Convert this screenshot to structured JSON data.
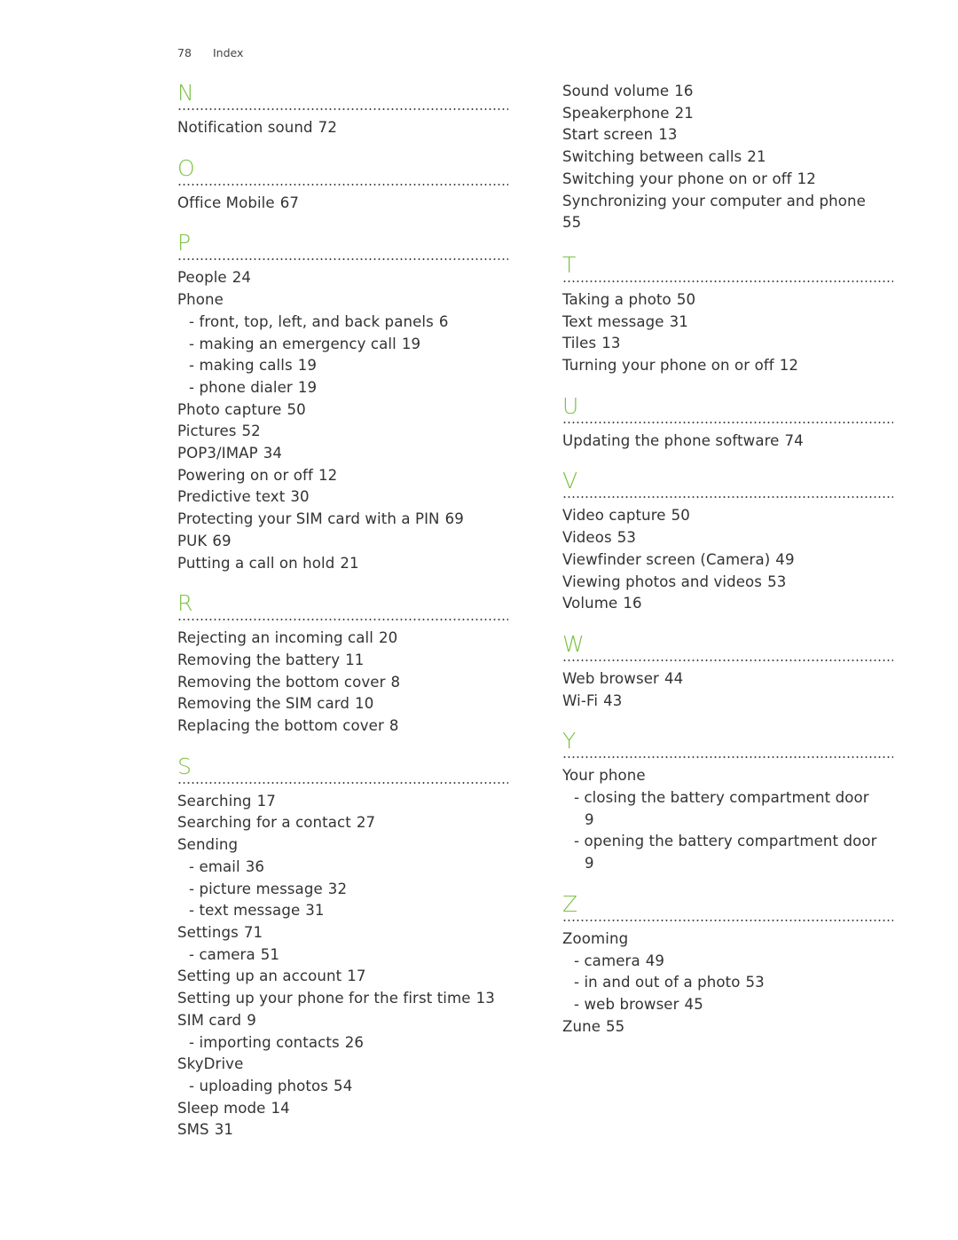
{
  "header": {
    "page_number": "78",
    "title": "Index"
  },
  "accent_color": "#7cc143",
  "left_column": [
    {
      "letter": "N",
      "entries": [
        {
          "text": "Notification sound",
          "page": "72",
          "level": 0
        }
      ]
    },
    {
      "letter": "O",
      "entries": [
        {
          "text": "Office Mobile",
          "page": "67",
          "level": 0
        }
      ]
    },
    {
      "letter": "P",
      "entries": [
        {
          "text": "People",
          "page": "24",
          "level": 0
        },
        {
          "text": "Phone",
          "page": "",
          "level": 0
        },
        {
          "text": "- front, top, left, and back panels",
          "page": "6",
          "level": 1
        },
        {
          "text": "- making an emergency call",
          "page": "19",
          "level": 1
        },
        {
          "text": "- making calls",
          "page": "19",
          "level": 1
        },
        {
          "text": "- phone dialer",
          "page": "19",
          "level": 1
        },
        {
          "text": "Photo capture",
          "page": "50",
          "level": 0
        },
        {
          "text": "Pictures",
          "page": "52",
          "level": 0
        },
        {
          "text": "POP3/IMAP",
          "page": "34",
          "level": 0
        },
        {
          "text": "Powering on or off",
          "page": "12",
          "level": 0
        },
        {
          "text": "Predictive text",
          "page": "30",
          "level": 0
        },
        {
          "text": "Protecting your SIM card with a PIN",
          "page": "69",
          "level": 0
        },
        {
          "text": "PUK",
          "page": "69",
          "level": 0
        },
        {
          "text": "Putting a call on hold",
          "page": "21",
          "level": 0
        }
      ]
    },
    {
      "letter": "R",
      "entries": [
        {
          "text": "Rejecting an incoming call",
          "page": "20",
          "level": 0
        },
        {
          "text": "Removing the battery",
          "page": "11",
          "level": 0
        },
        {
          "text": "Removing the bottom cover",
          "page": "8",
          "level": 0
        },
        {
          "text": "Removing the SIM card",
          "page": "10",
          "level": 0
        },
        {
          "text": "Replacing the bottom cover",
          "page": "8",
          "level": 0
        }
      ]
    },
    {
      "letter": "S",
      "entries": [
        {
          "text": "Searching",
          "page": "17",
          "level": 0
        },
        {
          "text": "Searching for a contact",
          "page": "27",
          "level": 0
        },
        {
          "text": "Sending",
          "page": "",
          "level": 0
        },
        {
          "text": "- email",
          "page": "36",
          "level": 1
        },
        {
          "text": "- picture message",
          "page": "32",
          "level": 1
        },
        {
          "text": "- text message",
          "page": "31",
          "level": 1
        },
        {
          "text": "Settings",
          "page": "71",
          "level": 0
        },
        {
          "text": "- camera",
          "page": "51",
          "level": 1
        },
        {
          "text": "Setting up an account",
          "page": "17",
          "level": 0
        },
        {
          "text": "Setting up your phone for the first time",
          "page": "13",
          "level": 0
        },
        {
          "text": "SIM card",
          "page": "9",
          "level": 0
        },
        {
          "text": "- importing contacts",
          "page": "26",
          "level": 1
        },
        {
          "text": "SkyDrive",
          "page": "",
          "level": 0
        },
        {
          "text": "- uploading photos",
          "page": "54",
          "level": 1
        },
        {
          "text": "Sleep mode",
          "page": "14",
          "level": 0
        },
        {
          "text": "SMS",
          "page": "31",
          "level": 0
        }
      ]
    }
  ],
  "right_column": [
    {
      "letter": "",
      "entries": [
        {
          "text": "Sound volume",
          "page": "16",
          "level": 0
        },
        {
          "text": "Speakerphone",
          "page": "21",
          "level": 0
        },
        {
          "text": "Start screen",
          "page": "13",
          "level": 0
        },
        {
          "text": "Switching between calls",
          "page": "21",
          "level": 0
        },
        {
          "text": "Switching your phone on or off",
          "page": "12",
          "level": 0
        },
        {
          "text": "Synchronizing your computer and phone",
          "page": "55",
          "level": 0,
          "wrap": true
        }
      ]
    },
    {
      "letter": "T",
      "entries": [
        {
          "text": "Taking a photo",
          "page": "50",
          "level": 0
        },
        {
          "text": "Text message",
          "page": "31",
          "level": 0
        },
        {
          "text": "Tiles",
          "page": "13",
          "level": 0
        },
        {
          "text": "Turning your phone on or off",
          "page": "12",
          "level": 0
        }
      ]
    },
    {
      "letter": "U",
      "entries": [
        {
          "text": "Updating the phone software",
          "page": "74",
          "level": 0
        }
      ]
    },
    {
      "letter": "V",
      "entries": [
        {
          "text": "Video capture",
          "page": "50",
          "level": 0
        },
        {
          "text": "Videos",
          "page": "53",
          "level": 0
        },
        {
          "text": "Viewfinder screen (Camera)",
          "page": "49",
          "level": 0
        },
        {
          "text": "Viewing photos and videos",
          "page": "53",
          "level": 0
        },
        {
          "text": "Volume",
          "page": "16",
          "level": 0
        }
      ]
    },
    {
      "letter": "W",
      "entries": [
        {
          "text": "Web browser",
          "page": "44",
          "level": 0
        },
        {
          "text": "Wi-Fi",
          "page": "43",
          "level": 0
        }
      ]
    },
    {
      "letter": "Y",
      "entries": [
        {
          "text": "Your phone",
          "page": "",
          "level": 0
        },
        {
          "text": "- closing the battery compartment door",
          "page": "9",
          "level": 1,
          "wrap": true
        },
        {
          "text": "- opening the battery compartment door",
          "page": "9",
          "level": 1,
          "wrap": true
        }
      ]
    },
    {
      "letter": "Z",
      "entries": [
        {
          "text": "Zooming",
          "page": "",
          "level": 0
        },
        {
          "text": "- camera",
          "page": "49",
          "level": 1
        },
        {
          "text": "- in and out of a photo",
          "page": "53",
          "level": 1
        },
        {
          "text": "- web browser",
          "page": "45",
          "level": 1
        },
        {
          "text": "Zune",
          "page": "55",
          "level": 0
        }
      ]
    }
  ]
}
